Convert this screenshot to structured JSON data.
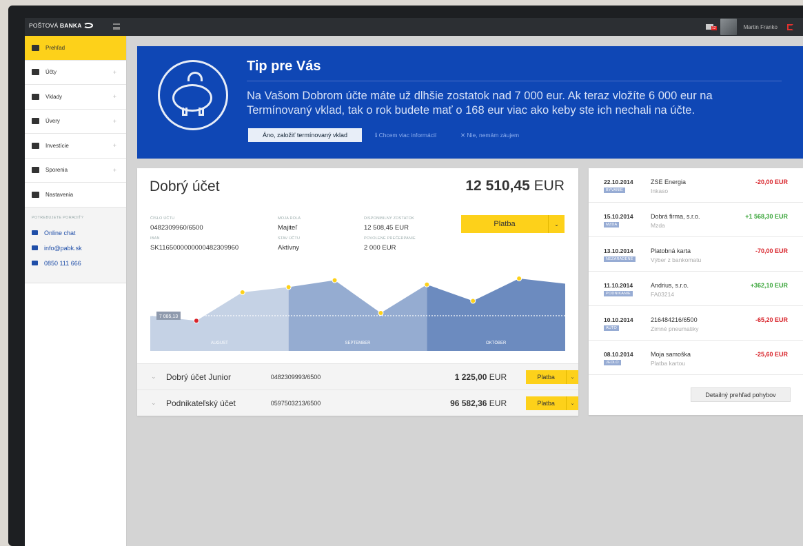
{
  "app": {
    "brand_light": "POŠTOVÁ",
    "brand_bold": "BANKA"
  },
  "topbar": {
    "username": "Martin Franko",
    "mail_badge": "12",
    "icons": [
      "hamburger-icon",
      "mail-icon",
      "logout-icon",
      "chat-icon"
    ]
  },
  "sidebar": {
    "items": [
      {
        "label": "Prehľad",
        "active": true,
        "icon": "user-icon"
      },
      {
        "label": "Účty",
        "icon": "wallet-icon",
        "expand": "+"
      },
      {
        "label": "Vklady",
        "icon": "deposit-icon",
        "expand": "+"
      },
      {
        "label": "Úvery",
        "icon": "moneybag-icon",
        "expand": "+"
      },
      {
        "label": "Investície",
        "icon": "chart-icon",
        "expand": "+"
      },
      {
        "label": "Sporenia",
        "icon": "piggy-icon",
        "expand": "+"
      },
      {
        "label": "Nastavenia",
        "icon": "gear-icon"
      }
    ],
    "help_title": "POTREBUJETE PORADIŤ?",
    "help": [
      {
        "label": "Online chat",
        "icon": "chat-icon"
      },
      {
        "label": "info@pabk.sk",
        "icon": "mail-icon"
      },
      {
        "label": "0850 111 666",
        "icon": "phone-icon"
      }
    ]
  },
  "tip": {
    "title": "Tip pre Vás",
    "text": "Na Vašom Dobrom účte máte už dlhšie zostatok nad 7 000 eur. Ak teraz vložíte 6 000 eur na Termínovaný vklad, tak o rok budete mať o 168 eur viac ako keby ste ich nechali na účte.",
    "cta": "Áno, založiť termínovaný vklad",
    "more": "ℹ Chcem viac informácií",
    "dismiss": "✕ Nie, nemám záujem"
  },
  "account": {
    "name": "Dobrý účet",
    "balance_amount": "12 510,45",
    "balance_currency": "EUR",
    "account_no_label": "ČÍSLO ÚČTU",
    "account_no": "0482309960/6500",
    "iban_label": "IBAN",
    "iban": "SK1165000000000482309960",
    "role_label": "MOJA ROLA",
    "role": "Majiteľ",
    "status_label": "STAV ÚČTU",
    "status": "Aktívny",
    "available_label": "DISPONIBILNÝ ZOSTATOK",
    "available": "12 508,45 EUR",
    "overdraft_label": "POVOLENÉ PREČERPANIE",
    "overdraft": "2 000 EUR",
    "pay_label": "Platba"
  },
  "chart_data": {
    "type": "area",
    "categories": [
      "AUGUST",
      "SEPTEMBER",
      "OKTÓBER"
    ],
    "x": [
      0,
      1,
      2,
      3,
      4,
      5,
      6,
      7,
      8,
      9
    ],
    "values": [
      7085.13,
      6500,
      9800,
      10400,
      11200,
      7400,
      10700,
      8800,
      11400,
      10800
    ],
    "ylim": [
      3000,
      13000
    ],
    "reference_label": "7 085,13",
    "reference_value": 7085.13,
    "colors": {
      "light": "#c5d2e5",
      "mid": "#95acd1",
      "dark": "#6c8bbf",
      "dot": "#fdd11a",
      "low": "#d8232a"
    }
  },
  "other_accounts": [
    {
      "name": "Dobrý účet Junior",
      "number": "0482309993/6500",
      "amount": "1 225,00",
      "currency": "EUR",
      "pay": "Platba"
    },
    {
      "name": "Podnikateľský účet",
      "number": "0597503213/6500",
      "amount": "96 582,36",
      "currency": "EUR",
      "pay": "Platba"
    }
  ],
  "transactions": [
    {
      "date": "22.10.2014",
      "tag": "BÝVANIE",
      "name": "ZSE Energia",
      "desc": "Inkaso",
      "amount": "-20,00 EUR",
      "sign": "neg"
    },
    {
      "date": "15.10.2014",
      "tag": "MZDA",
      "name": "Dobrá firma, s.r.o.",
      "desc": "Mzda",
      "amount": "+1 568,30 EUR",
      "sign": "pos"
    },
    {
      "date": "13.10.2014",
      "tag": "NEZARADENÉ",
      "name": "Platobná karta",
      "desc": "Výber z bankomatu",
      "amount": "-70,00 EUR",
      "sign": "neg"
    },
    {
      "date": "11.10.2014",
      "tag": "PODNIKANIE",
      "name": "Andrius, s.r.o.",
      "desc": "FA03214",
      "amount": "+362,10 EUR",
      "sign": "pos"
    },
    {
      "date": "10.10.2014",
      "tag": "AUTO",
      "name": "216484216/6500",
      "desc": "Zimné pneumatiky",
      "amount": "-65,20 EUR",
      "sign": "neg"
    },
    {
      "date": "08.10.2014",
      "tag": "JEDLO",
      "name": "Moja samoška",
      "desc": "Platba kartou",
      "amount": "-25,60 EUR",
      "sign": "neg"
    }
  ],
  "transactions_button": "Detailný prehľad pohybov"
}
